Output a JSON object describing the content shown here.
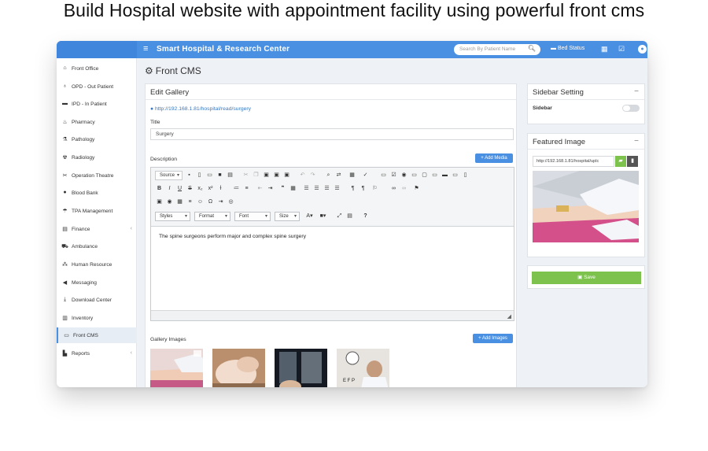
{
  "headline": "Build Hospital website with appointment facility using powerful front cms",
  "topbar": {
    "menu_glyph": "≡",
    "title": "Smart Hospital & Research Center",
    "search_placeholder": "Search By Patient Name",
    "bed_status": "Bed Status"
  },
  "sidebar": {
    "items": [
      {
        "label": "Front Office",
        "icon": "building-icon"
      },
      {
        "label": "OPD - Out Patient",
        "icon": "stethoscope-icon"
      },
      {
        "label": "IPD - In Patient",
        "icon": "bed-icon"
      },
      {
        "label": "Pharmacy",
        "icon": "mortar-icon"
      },
      {
        "label": "Pathology",
        "icon": "flask-icon"
      },
      {
        "label": "Radiology",
        "icon": "radiology-icon"
      },
      {
        "label": "Operation Theatre",
        "icon": "scissors-icon"
      },
      {
        "label": "Blood Bank",
        "icon": "drop-icon"
      },
      {
        "label": "TPA Management",
        "icon": "umbrella-icon"
      },
      {
        "label": "Finance",
        "icon": "money-icon",
        "chevron": "‹"
      },
      {
        "label": "Ambulance",
        "icon": "ambulance-icon"
      },
      {
        "label": "Human Resource",
        "icon": "sitemap-icon"
      },
      {
        "label": "Messaging",
        "icon": "bullhorn-icon"
      },
      {
        "label": "Download Center",
        "icon": "download-icon"
      },
      {
        "label": "Inventory",
        "icon": "inventory-icon"
      },
      {
        "label": "Front CMS",
        "icon": "cms-icon",
        "active": true
      },
      {
        "label": "Reports",
        "icon": "chart-icon",
        "chevron": "‹"
      }
    ]
  },
  "page": {
    "title": "Front CMS"
  },
  "edit_gallery": {
    "heading": "Edit Gallery",
    "link": "http://192.168.1.81/hospital/read/surgery",
    "title_label": "Title",
    "title_value": "Surgery",
    "description_label": "Description",
    "add_media": "+ Add Media",
    "editor": {
      "source_label": "Source",
      "styles": "Styles",
      "format": "Format",
      "font": "Font",
      "size": "Size",
      "body_text": "The spine surgeons perform major and complex spine surgery"
    },
    "gallery_label": "Gallery Images",
    "add_images": "+ Add Images"
  },
  "sidebar_setting": {
    "heading": "Sidebar Setting",
    "minus": "−",
    "sidebar_label": "Sidebar"
  },
  "featured_image": {
    "heading": "Featured Image",
    "minus": "−",
    "url": "http://192.168.1.81/hospital/uplc"
  },
  "save": {
    "label": "Save"
  },
  "colors": {
    "brand": "#4a90e2",
    "save": "#7cc24c"
  }
}
